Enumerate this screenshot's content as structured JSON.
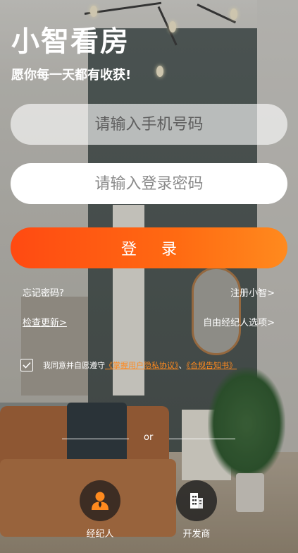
{
  "app": {
    "title": "小智看房",
    "slogan": "愿你每一天都有收获!"
  },
  "form": {
    "phone_placeholder": "请输入手机号码",
    "password_placeholder": "请输入登录密码",
    "login_label": "登 录"
  },
  "links": {
    "forgot": "忘记密码?",
    "register": "注册小智>",
    "update": "检查更新>",
    "free_broker": "自由经纪人选项>"
  },
  "agreement": {
    "checked": true,
    "prefix": "我同意并自愿遵守",
    "privacy_link": "《掌握用户隐私协议》",
    "separator": "、",
    "compliance_link": "《合规告知书》"
  },
  "divider": {
    "text": "or"
  },
  "roles": [
    {
      "label": "经纪人",
      "icon": "person-icon"
    },
    {
      "label": "开发商",
      "icon": "building-icon"
    }
  ],
  "colors": {
    "accent_start": "#ff4a12",
    "accent_end": "#ff8a1e",
    "link_orange": "#ff8a1e",
    "agent_icon": "#ff8a1e"
  }
}
